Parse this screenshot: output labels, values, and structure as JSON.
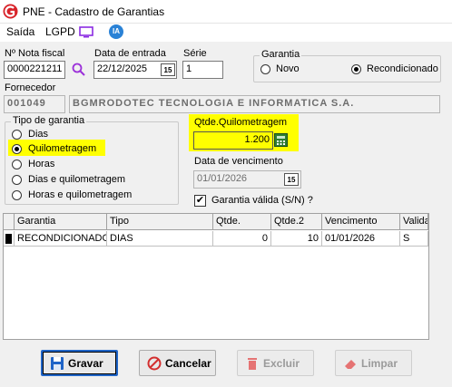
{
  "window": {
    "title": "PNE - Cadastro de Garantias"
  },
  "menu": {
    "items": [
      "Saída",
      "LGPD"
    ],
    "ia_label": "IA"
  },
  "form": {
    "nota_fiscal_label": "Nº Nota fiscal",
    "nota_fiscal_value": "0000221211",
    "data_entrada_label": "Data de entrada",
    "data_entrada_value": "22/12/2025",
    "serie_label": "Série",
    "serie_value": "1",
    "calendar_glyph": "15",
    "fornecedor_label": "Fornecedor",
    "fornecedor_code": "001049",
    "fornecedor_name": "BGMRODOTEC TECNOLOGIA E INFORMATICA S.A.",
    "qtde_km_label": "Qtde.Quilometragem",
    "qtde_km_value": "1.200",
    "data_vencimento_label": "Data de vencimento",
    "data_vencimento_value": "01/01/2026",
    "garantia_valida_label": "Garantia válida (S/N) ?",
    "garantia_valida_checked": true
  },
  "garantia_group": {
    "title": "Garantia",
    "options": [
      "Novo",
      "Recondicionado"
    ],
    "selected": "Recondicionado"
  },
  "tipo_group": {
    "title": "Tipo de garantia",
    "options": [
      "Dias",
      "Quilometragem",
      "Horas",
      "Dias e quilometragem",
      "Horas e quilometragem"
    ],
    "selected": "Quilometragem"
  },
  "grid": {
    "columns": [
      "Garantia",
      "Tipo",
      "Qtde.",
      "Qtde.2",
      "Vencimento",
      "Valida"
    ],
    "rows": [
      [
        "RECONDICIONADO",
        "DIAS",
        "0",
        "10",
        "01/01/2026",
        "S"
      ]
    ]
  },
  "buttons": {
    "gravar": "Gravar",
    "cancelar": "Cancelar",
    "excluir": "Excluir",
    "limpar": "Limpar"
  },
  "colors": {
    "highlight": "#ffff00",
    "accent": "#1f64c7",
    "logo": "#d8232a"
  }
}
